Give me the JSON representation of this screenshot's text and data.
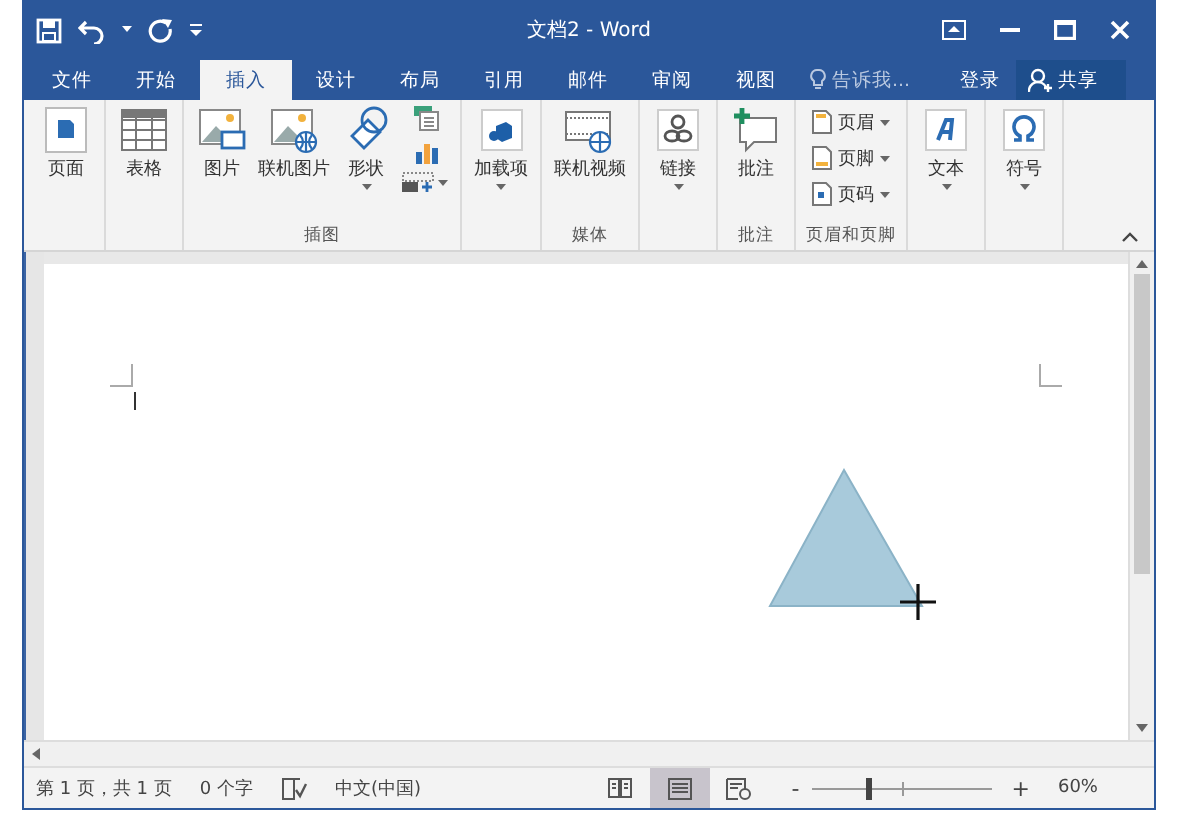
{
  "window": {
    "title": "文档2 - Word"
  },
  "tabs": [
    {
      "label": "文件",
      "selected": false
    },
    {
      "label": "开始",
      "selected": false
    },
    {
      "label": "插入",
      "selected": true
    },
    {
      "label": "设计",
      "selected": false
    },
    {
      "label": "布局",
      "selected": false
    },
    {
      "label": "引用",
      "selected": false
    },
    {
      "label": "邮件",
      "selected": false
    },
    {
      "label": "审阅",
      "selected": false
    },
    {
      "label": "视图",
      "selected": false
    }
  ],
  "tell_me": {
    "placeholder": "告诉我..."
  },
  "account": {
    "sign_in": "登录",
    "share": "共享"
  },
  "ribbon": {
    "groups": [
      {
        "items": [
          {
            "kind": "large",
            "label": "页面",
            "dropdown": false
          }
        ]
      },
      {
        "items": [
          {
            "kind": "large",
            "label": "表格",
            "dropdown": false
          }
        ]
      },
      {
        "label": "插图",
        "items": [
          {
            "kind": "large",
            "label": "图片",
            "dropdown": false
          },
          {
            "kind": "large",
            "label": "联机图片",
            "dropdown": false
          },
          {
            "kind": "large",
            "label": "形状",
            "dropdown": true
          },
          {
            "kind": "stack",
            "dropdown": true
          }
        ]
      },
      {
        "items": [
          {
            "kind": "large",
            "label": "加载项",
            "dropdown": true
          }
        ]
      },
      {
        "label": "媒体",
        "items": [
          {
            "kind": "large",
            "label": "联机视频",
            "dropdown": false
          }
        ]
      },
      {
        "items": [
          {
            "kind": "large",
            "label": "链接",
            "dropdown": true
          }
        ]
      },
      {
        "label": "批注",
        "items": [
          {
            "kind": "large",
            "label": "批注",
            "dropdown": false
          }
        ]
      },
      {
        "label": "页眉和页脚",
        "items": [
          {
            "kind": "small",
            "label": "页眉",
            "dropdown": true
          },
          {
            "kind": "small",
            "label": "页脚",
            "dropdown": true
          },
          {
            "kind": "small",
            "label": "页码",
            "dropdown": true
          }
        ]
      },
      {
        "items": [
          {
            "kind": "large",
            "label": "文本",
            "dropdown": true
          }
        ]
      },
      {
        "items": [
          {
            "kind": "large",
            "label": "符号",
            "dropdown": true
          }
        ]
      }
    ]
  },
  "status_bar": {
    "page": "第 1 页，共 1 页",
    "words": "0 个字",
    "language": "中文(中国)",
    "views": [
      {
        "selected": false
      },
      {
        "selected": true
      },
      {
        "selected": false
      }
    ],
    "zoom_out": "-",
    "zoom_in": "+",
    "zoom": {
      "level": 0.3
    },
    "zoom_text": "60%"
  }
}
